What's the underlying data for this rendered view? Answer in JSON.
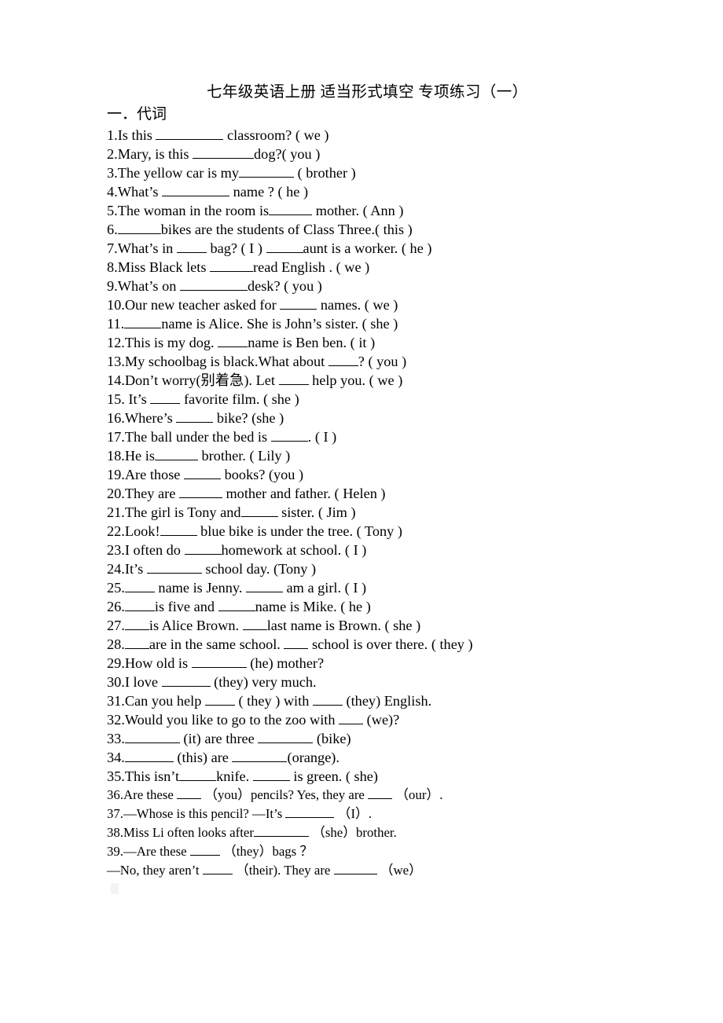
{
  "document": {
    "title": "七年级英语上册 适当形式填空 专项练习（一）",
    "section_heading": "一．代词"
  },
  "items": [
    {
      "n": "1.",
      "parts": [
        "Is this ",
        {
          "blank": 11
        },
        " classroom? ( we )"
      ]
    },
    {
      "n": "2.",
      "parts": [
        "Mary, is this ",
        {
          "blank": 10
        },
        "dog?( you )"
      ]
    },
    {
      "n": "3.",
      "parts": [
        "The yellow car is my",
        {
          "blank": 9
        },
        " ( brother )"
      ]
    },
    {
      "n": "4.",
      "parts": [
        "What’s ",
        {
          "blank": 11
        },
        " name ? ( he )"
      ]
    },
    {
      "n": "5.",
      "parts": [
        "The woman in the room is",
        {
          "blank": 7
        },
        " mother. ( Ann )"
      ]
    },
    {
      "n": "6.",
      "parts": [
        {
          "blank": 7
        },
        "bikes are the students of Class Three.( this )"
      ]
    },
    {
      "n": "7.",
      "parts": [
        "What’s in ",
        {
          "blank": 5
        },
        " bag? ( I ) ",
        {
          "blank": 6
        },
        "aunt is a worker. ( he )"
      ]
    },
    {
      "n": "8.",
      "parts": [
        "Miss Black lets ",
        {
          "blank": 7
        },
        "read English . ( we )"
      ]
    },
    {
      "n": "9.",
      "parts": [
        "What’s on ",
        {
          "blank": 11
        },
        "desk? ( you )"
      ]
    },
    {
      "n": "10.",
      "parts": [
        "Our new teacher asked for ",
        {
          "blank": 6
        },
        " names. ( we )"
      ]
    },
    {
      "n": "11.",
      "parts": [
        {
          "blank": 6
        },
        "name is Alice. She is John’s sister. ( she )"
      ]
    },
    {
      "n": "12.",
      "parts": [
        "This is my dog. ",
        {
          "blank": 5
        },
        "name is Ben ben. ( it )"
      ]
    },
    {
      "n": "13.",
      "parts": [
        "My schoolbag is black.What about ",
        {
          "blank": 5
        },
        "? ( you )"
      ]
    },
    {
      "n": "14.",
      "parts": [
        "Don’t worry(别着急). Let ",
        {
          "blank": 5
        },
        " help you. ( we )"
      ]
    },
    {
      "n": "15.",
      "parts": [
        " It’s ",
        {
          "blank": 5
        },
        " favorite film. ( she )"
      ]
    },
    {
      "n": "16.",
      "parts": [
        "Where’s ",
        {
          "blank": 6
        },
        " bike? (she )"
      ]
    },
    {
      "n": "17.",
      "parts": [
        "The ball under the bed is ",
        {
          "blank": 6
        },
        ". ( I )"
      ]
    },
    {
      "n": "18.",
      "parts": [
        "He is",
        {
          "blank": 7
        },
        " brother. ( Lily )"
      ]
    },
    {
      "n": "19.",
      "parts": [
        "Are those ",
        {
          "blank": 6
        },
        " books? (you )"
      ]
    },
    {
      "n": "20.",
      "parts": [
        "They are ",
        {
          "blank": 7
        },
        " mother and father. ( Helen )"
      ]
    },
    {
      "n": "21.",
      "parts": [
        "The girl is Tony and",
        {
          "blank": 6
        },
        " sister. ( Jim )"
      ]
    },
    {
      "n": "22.",
      "parts": [
        "Look!",
        {
          "blank": 6
        },
        " blue bike is under the tree. ( Tony )"
      ]
    },
    {
      "n": "23.",
      "parts": [
        "I often do ",
        {
          "blank": 6
        },
        "homework at school. ( I )"
      ]
    },
    {
      "n": "24.",
      "parts": [
        "It’s ",
        {
          "blank": 9
        },
        " school day. (Tony )"
      ]
    },
    {
      "n": "25.",
      "parts": [
        {
          "blank": 5
        },
        " name is Jenny. ",
        {
          "blank": 6
        },
        " am a girl. ( I )"
      ]
    },
    {
      "n": "26.",
      "parts": [
        {
          "blank": 5
        },
        "is five and ",
        {
          "blank": 6
        },
        "name is Mike. ( he )"
      ]
    },
    {
      "n": "27.",
      "parts": [
        {
          "blank": 4
        },
        "is Alice Brown. ",
        {
          "blank": 4
        },
        "last name is Brown. ( she )"
      ]
    },
    {
      "n": "28.",
      "parts": [
        {
          "blank": 4
        },
        "are in the same school. ",
        {
          "blank": 4
        },
        " school is over there. ( they )"
      ]
    },
    {
      "n": "29.",
      "parts": [
        "How old is ",
        {
          "blank": 9
        },
        " (he) mother?"
      ]
    },
    {
      "n": "30.",
      "parts": [
        "I love ",
        {
          "blank": 8
        },
        " (they) very much."
      ]
    },
    {
      "n": "31.",
      "parts": [
        "Can you help ",
        {
          "blank": 5
        },
        " ( they ) with ",
        {
          "blank": 5
        },
        " (they) English."
      ]
    },
    {
      "n": "32.",
      "parts": [
        "Would you like to go to the zoo with ",
        {
          "blank": 4
        },
        " (we)?"
      ]
    },
    {
      "n": "33.",
      "parts": [
        {
          "blank": 9
        },
        " (it) are three ",
        {
          "blank": 9
        },
        " (bike)"
      ]
    },
    {
      "n": "34.",
      "parts": [
        {
          "blank": 8
        },
        " (this) are ",
        {
          "blank": 9
        },
        "(orange)."
      ]
    },
    {
      "n": "35.",
      "parts": [
        "This isn’t",
        {
          "blank": 6
        },
        "knife. ",
        {
          "blank": 6
        },
        " is green. ( she)"
      ]
    },
    {
      "n": "36.",
      "parts": [
        "Are these ",
        {
          "blank": 4
        },
        " （you）pencils? Yes, they are ",
        {
          "blank": 4
        },
        " （our）."
      ],
      "small": true
    },
    {
      "n": "37.",
      "parts": [
        "—Whose is this pencil? —It’s ",
        {
          "blank": 8
        },
        " （I）."
      ],
      "small": true
    },
    {
      "n": "38.",
      "parts": [
        "Miss Li often looks after",
        {
          "blank": 9
        },
        " （she）brother."
      ],
      "small": true
    },
    {
      "n": "39.",
      "parts": [
        "—Are these ",
        {
          "blank": 5
        },
        " （they）bags ？"
      ],
      "small": true
    },
    {
      "n": "",
      "parts": [
        "—No, they aren’t ",
        {
          "blank": 5
        },
        " （their). They are ",
        {
          "blank": 7
        },
        " （we）"
      ],
      "small": true
    }
  ]
}
